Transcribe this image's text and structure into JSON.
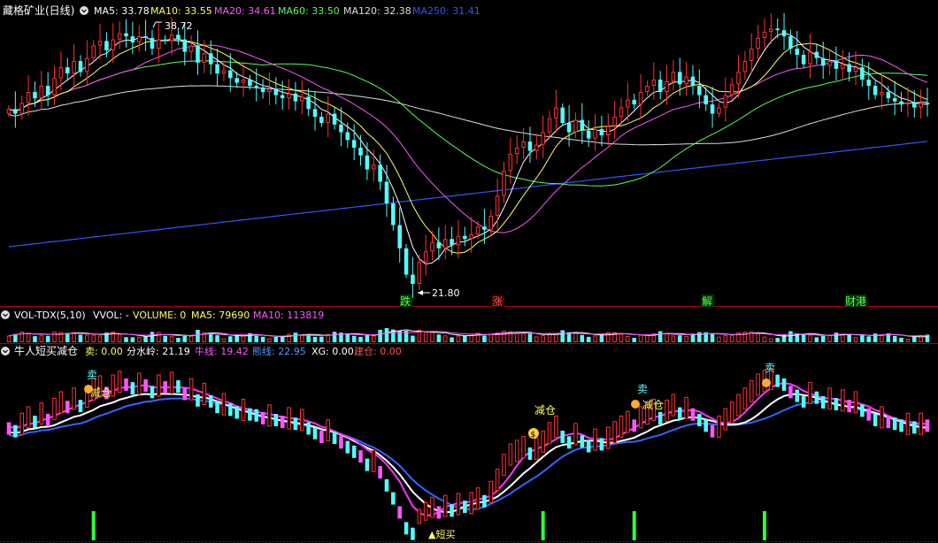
{
  "main_panel": {
    "title": "藏格矿业(日线)",
    "legend": [
      {
        "label": "MA5: 33.78",
        "color": "#ffffff"
      },
      {
        "label": "MA10: 33.55",
        "color": "#ffff55"
      },
      {
        "label": "MA20: 34.61",
        "color": "#ff55ff"
      },
      {
        "label": "MA60: 33.50",
        "color": "#55ff55"
      },
      {
        "label": "MA120: 32.38",
        "color": "#dddddd"
      },
      {
        "label": "MA250: 31.41",
        "color": "#3355ff"
      }
    ],
    "high_label": "38.72",
    "low_label": "21.80",
    "markers": [
      {
        "text": "跌",
        "color": "#55ff55"
      },
      {
        "text": "涨",
        "color": "#ff5555"
      },
      {
        "text": "解",
        "color": "#55ff55"
      },
      {
        "text": "财港",
        "color": "#55ff55"
      }
    ]
  },
  "volume_panel": {
    "title": "VOL-TDX(5,10)",
    "legend": [
      {
        "label": "VVOL: -",
        "color": "#ffffff"
      },
      {
        "label": "VOLUME: 0",
        "color": "#ffff55"
      },
      {
        "label": "MA5: 79690",
        "color": "#ffff55"
      },
      {
        "label": "MA10: 113819",
        "color": "#ff55ff"
      }
    ]
  },
  "indicator_panel": {
    "title": "牛人短买减仓",
    "legend": [
      {
        "label": "卖: 0.00",
        "color": "#ffff55"
      },
      {
        "label": "分水岭: 21.19",
        "color": "#ffffff"
      },
      {
        "label": "牛线: 19.42",
        "color": "#ff55ff"
      },
      {
        "label": "熊线: 22.95",
        "color": "#5599ff"
      },
      {
        "label": "XG: 0.00",
        "color": "#ffffff"
      },
      {
        "label": "建仓: 0.00",
        "color": "#ff5555"
      }
    ],
    "signals": [
      {
        "text": "卖",
        "color": "#55ffff"
      },
      {
        "text": "减仓",
        "color": "#ffff55"
      },
      {
        "text": "减仓",
        "color": "#ffff55"
      },
      {
        "text": "卖",
        "color": "#55ffff"
      },
      {
        "text": "减仓",
        "color": "#ffff55"
      },
      {
        "text": "卖",
        "color": "#55ffff"
      },
      {
        "text": "▲短买",
        "color": "#ffff55"
      }
    ]
  },
  "chart_data": {
    "type": "candlestick",
    "colors": {
      "up": "#ff3232",
      "down": "#54fcfc",
      "ma250": "#3355ff",
      "ma120": "#dddddd",
      "ma60": "#55ff55",
      "ma20": "#ff55ff",
      "ma10": "#ffff55",
      "ma5": "#ffffff"
    },
    "close": [
      33.5,
      33.2,
      33.9,
      34.6,
      34.2,
      35.0,
      34.4,
      35.5,
      36.2,
      35.8,
      36.6,
      35.9,
      36.8,
      37.6,
      37.9,
      37.3,
      38.0,
      38.4,
      38.2,
      37.8,
      38.2,
      38.1,
      37.4,
      38.0,
      37.9,
      38.3,
      38.0,
      37.2,
      37.6,
      36.5,
      37.1,
      36.4,
      35.8,
      36.0,
      35.5,
      35.2,
      35.4,
      35.0,
      34.9,
      34.6,
      34.8,
      34.4,
      34.2,
      34.5,
      34.0,
      34.3,
      33.5,
      33.0,
      32.6,
      33.2,
      32.5,
      32.0,
      31.5,
      31.0,
      30.5,
      29.6,
      29.9,
      28.8,
      27.4,
      26.0,
      24.5,
      22.8,
      22.2,
      23.6,
      24.3,
      24.9,
      24.5,
      25.1,
      24.7,
      25.3,
      25.1,
      25.4,
      25.9,
      25.7,
      26.6,
      27.9,
      29.5,
      30.6,
      31.0,
      31.4,
      30.8,
      31.2,
      32.0,
      32.9,
      33.6,
      32.6,
      32.0,
      32.8,
      32.1,
      31.6,
      32.2,
      31.8,
      32.4,
      33.0,
      33.6,
      34.1,
      33.8,
      34.6,
      35.0,
      35.4,
      34.6,
      35.3,
      35.9,
      35.1,
      35.6,
      35.0,
      34.4,
      33.8,
      33.2,
      33.6,
      34.4,
      35.1,
      35.9,
      36.6,
      37.4,
      38.1,
      38.5,
      38.7,
      38.6,
      38.2,
      37.4,
      37.0,
      36.4,
      37.2,
      36.8,
      36.3,
      36.6,
      36.1,
      36.4,
      35.9,
      36.2,
      35.4,
      35.0,
      34.4,
      34.6,
      34.2,
      34.0,
      33.8,
      33.9,
      33.6,
      33.9,
      33.8
    ]
  }
}
